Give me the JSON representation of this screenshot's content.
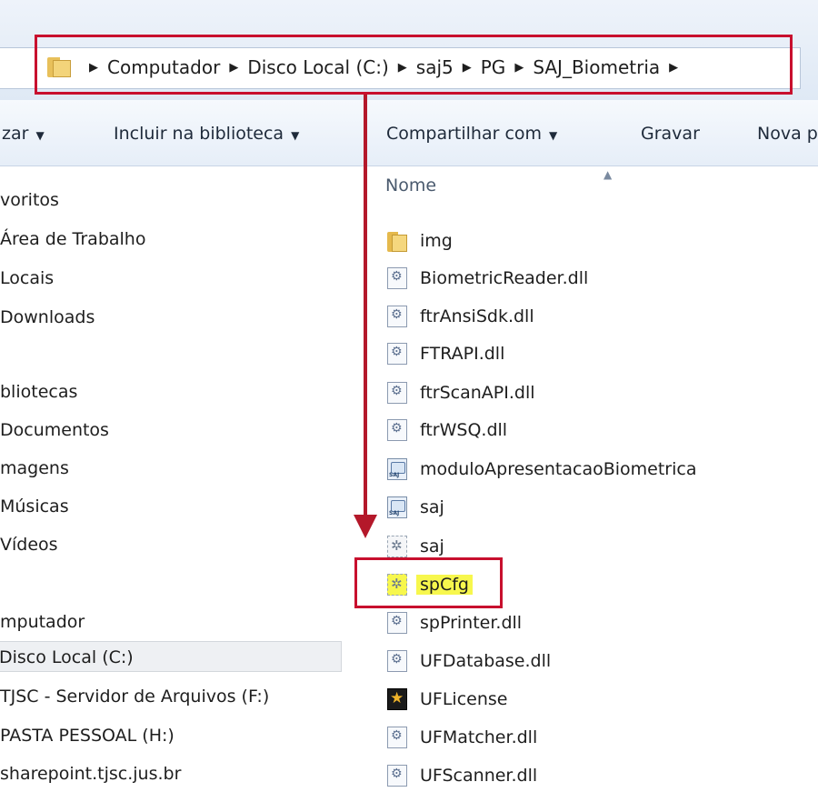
{
  "address": {
    "left_glyph": ")",
    "crumbs": [
      "Computador",
      "Disco Local (C:)",
      "saj5",
      "PG",
      "SAJ_Biometria"
    ]
  },
  "toolbar": {
    "organize": "zar",
    "include_library": "Incluir na biblioteca",
    "share_with": "Compartilhar com",
    "burn": "Gravar",
    "new_folder": "Nova p"
  },
  "nav": {
    "items": [
      "voritos",
      "Área de Trabalho",
      "Locais",
      "Downloads",
      "bliotecas",
      "Documentos",
      "magens",
      "Músicas",
      "Vídeos",
      "mputador",
      "Disco Local (C:)",
      "TJSC - Servidor de Arquivos (F:)",
      "PASTA PESSOAL (H:)",
      "sharepoint.tjsc.jus.br"
    ],
    "selected_index": 10
  },
  "files": {
    "column_name": "Nome",
    "items": [
      {
        "name": "img",
        "icon": "folder-icon"
      },
      {
        "name": "BiometricReader.dll",
        "icon": "dll-file-icon"
      },
      {
        "name": "ftrAnsiSdk.dll",
        "icon": "dll-file-icon"
      },
      {
        "name": "FTRAPI.dll",
        "icon": "dll-file-icon"
      },
      {
        "name": "ftrScanAPI.dll",
        "icon": "dll-file-icon"
      },
      {
        "name": "ftrWSQ.dll",
        "icon": "dll-file-icon"
      },
      {
        "name": "moduloApresentacaoBiometrica",
        "icon": "saj-app-icon"
      },
      {
        "name": "saj",
        "icon": "saj-app-icon"
      },
      {
        "name": "saj",
        "icon": "config-file-icon"
      },
      {
        "name": "spCfg",
        "icon": "config-file-icon",
        "highlighted": true
      },
      {
        "name": "spPrinter.dll",
        "icon": "dll-file-icon"
      },
      {
        "name": "UFDatabase.dll",
        "icon": "dll-file-icon"
      },
      {
        "name": "UFLicense",
        "icon": "license-icon"
      },
      {
        "name": "UFMatcher.dll",
        "icon": "dll-file-icon"
      },
      {
        "name": "UFScanner.dll",
        "icon": "dll-file-icon"
      }
    ]
  },
  "colors": {
    "annotation_red": "#c8102e",
    "highlight_yellow": "#f7f74d"
  }
}
